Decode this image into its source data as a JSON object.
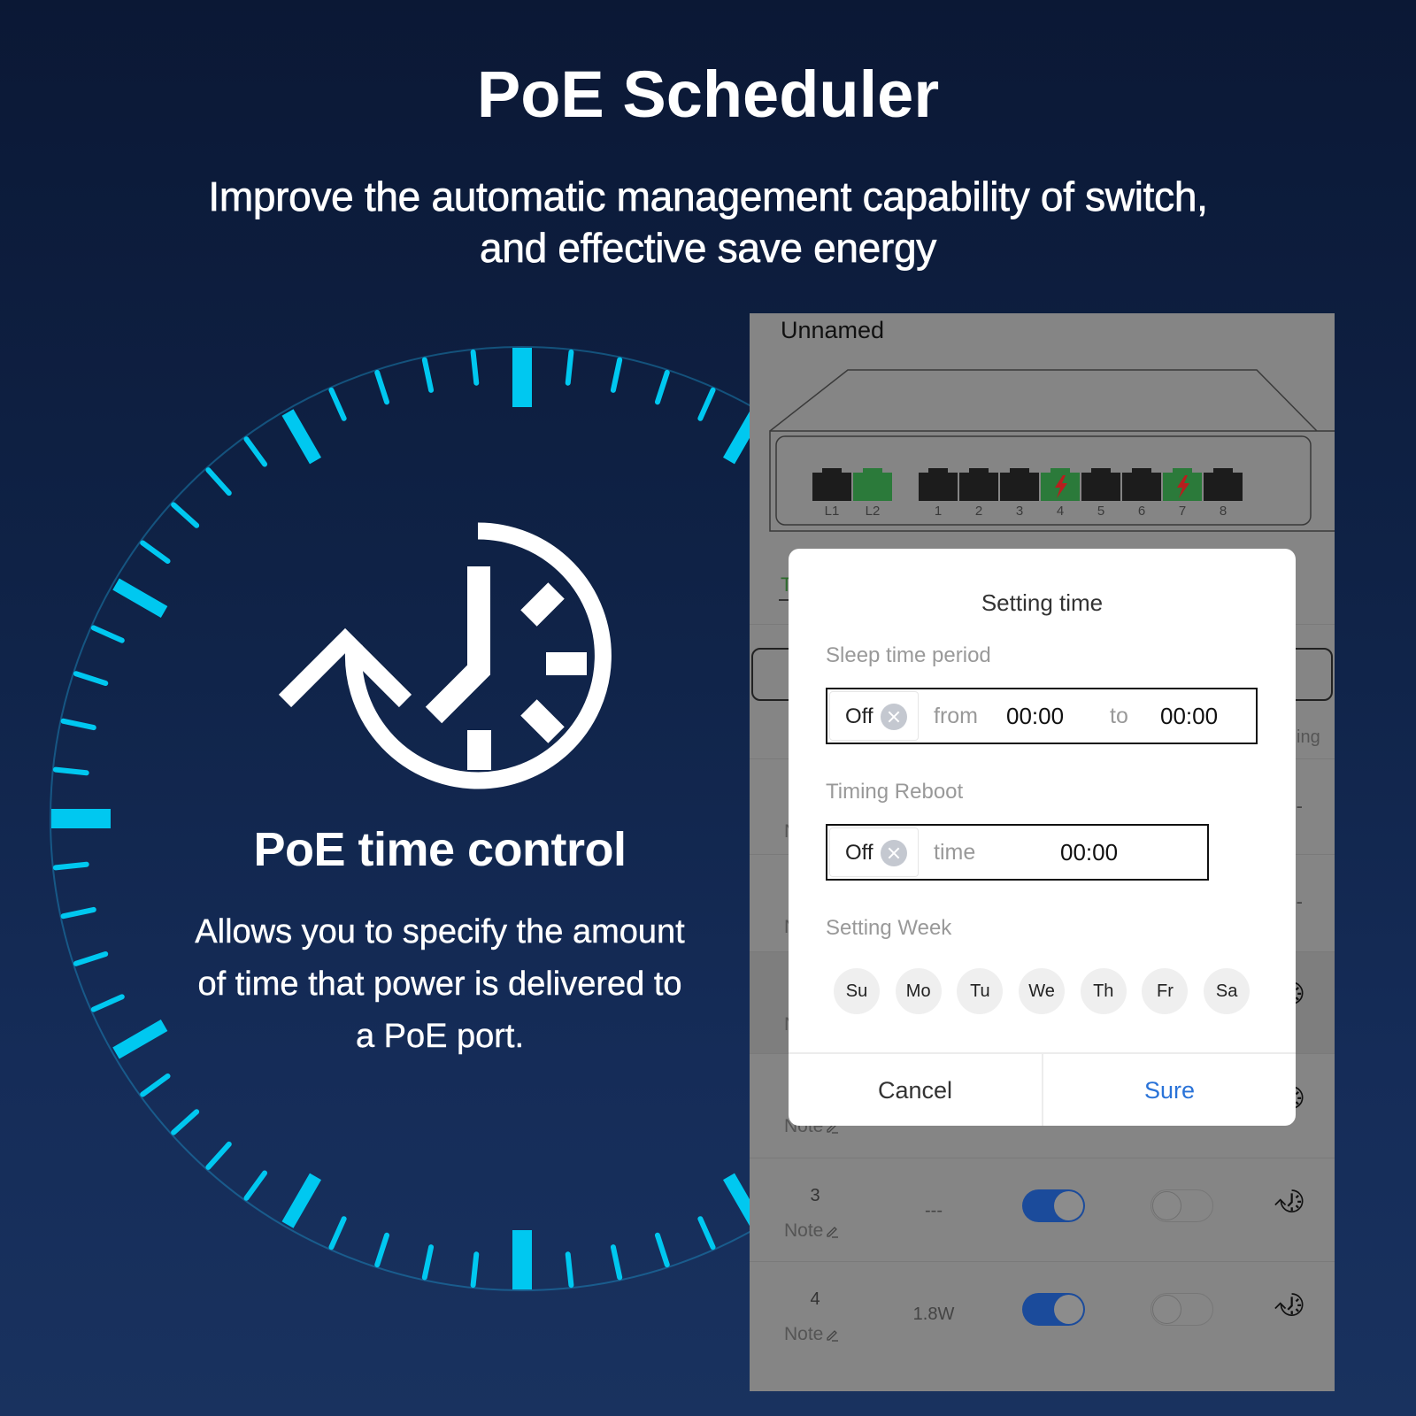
{
  "header": {
    "title": "PoE Scheduler",
    "subtitle_lines": [
      "Improve the automatic management capability of switch,",
      "and effective save energy"
    ]
  },
  "feature": {
    "icon": "clock-refresh-icon",
    "title": "PoE time control",
    "description_lines": [
      "Allows you to specify the amount",
      "of time that power is delivered to",
      "a PoE port."
    ]
  },
  "colors": {
    "dial_accent": "#00c8f0",
    "port_link": "#2b7a3a",
    "poe_bolt": "#b81e1e",
    "toggle_on": "#1b4b9b",
    "confirm_blue": "#2a73d8"
  },
  "app": {
    "device_name": "Unnamed",
    "ports": [
      {
        "label": "L1",
        "state": "idle"
      },
      {
        "label": "L2",
        "state": "link"
      },
      {
        "label": "1",
        "state": "idle"
      },
      {
        "label": "2",
        "state": "idle"
      },
      {
        "label": "3",
        "state": "idle"
      },
      {
        "label": "4",
        "state": "poe"
      },
      {
        "label": "5",
        "state": "idle"
      },
      {
        "label": "6",
        "state": "idle"
      },
      {
        "label": "7",
        "state": "poe"
      },
      {
        "label": "8",
        "state": "idle"
      }
    ],
    "tab_label_partial": "T",
    "column_header_partial": "ing",
    "rows": [
      {
        "note": "Note",
        "timing": "---"
      },
      {
        "note": "Note",
        "timing": "---"
      },
      {
        "note": "Note",
        "timing_icon": "clock-refresh-icon"
      },
      {
        "note": "Note",
        "timing_icon": "clock-refresh-icon"
      },
      {
        "port": "3",
        "note": "Note",
        "power": "---",
        "poe_enabled": true,
        "second_toggle_enabled": false,
        "timing_icon": "clock-refresh-icon"
      },
      {
        "port": "4",
        "note": "Note",
        "power": "1.8W",
        "poe_enabled": true,
        "second_toggle_enabled": false,
        "timing_icon": "clock-refresh-icon"
      }
    ]
  },
  "dialog": {
    "title": "Setting time",
    "sleep": {
      "label": "Sleep time period",
      "switch": "Off",
      "from_label": "from",
      "from_value": "00:00",
      "to_label": "to",
      "to_value": "00:00"
    },
    "reboot": {
      "label": "Timing Reboot",
      "switch": "Off",
      "time_label": "time",
      "time_value": "00:00"
    },
    "week": {
      "label": "Setting Week",
      "days": [
        "Su",
        "Mo",
        "Tu",
        "We",
        "Th",
        "Fr",
        "Sa"
      ]
    },
    "cancel_label": "Cancel",
    "confirm_label": "Sure"
  }
}
